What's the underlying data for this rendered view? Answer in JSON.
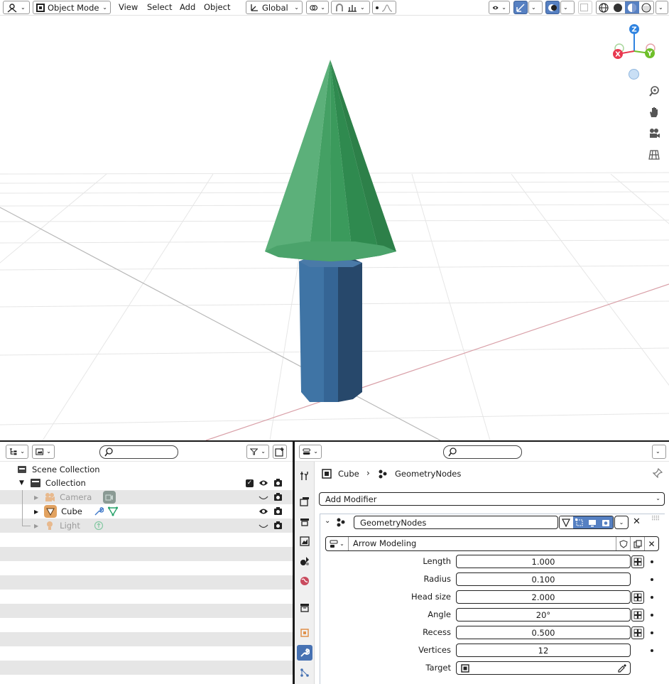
{
  "header": {
    "mode_label": "Object Mode",
    "menus": [
      "View",
      "Select",
      "Add",
      "Object"
    ],
    "orientation_label": "Global"
  },
  "viewport": {
    "gizmo": {
      "z": "Z",
      "x": "X",
      "y": "Y"
    },
    "tools": [
      "zoom-icon",
      "pan-hand-icon",
      "camera-view-icon",
      "grid-view-icon"
    ]
  },
  "outliner": {
    "scene_collection": "Scene Collection",
    "collection": "Collection",
    "items": [
      {
        "label": "Camera",
        "muted": true
      },
      {
        "label": "Cube",
        "muted": false
      },
      {
        "label": "Light",
        "muted": true
      }
    ]
  },
  "properties": {
    "breadcrumb": {
      "object": "Cube",
      "modifier": "GeometryNodes"
    },
    "add_modifier": "Add Modifier",
    "modifier_name": "GeometryNodes",
    "node_group": "Arrow Modeling",
    "params": [
      {
        "label": "Length",
        "value": "1.000"
      },
      {
        "label": "Radius",
        "value": "0.100"
      },
      {
        "label": "Head size",
        "value": "2.000"
      },
      {
        "label": "Angle",
        "value": "20°"
      },
      {
        "label": "Recess",
        "value": "0.500"
      },
      {
        "label": "Vertices",
        "value": "12"
      },
      {
        "label": "Target",
        "value": ""
      }
    ]
  },
  "colors": {
    "accent": "#4772b3",
    "cone_green": "#3fa061",
    "shaft_blue": "#3d6a94",
    "axis_x": "#e8384f",
    "axis_y": "#6fbf2a",
    "axis_z": "#2f83e0"
  }
}
